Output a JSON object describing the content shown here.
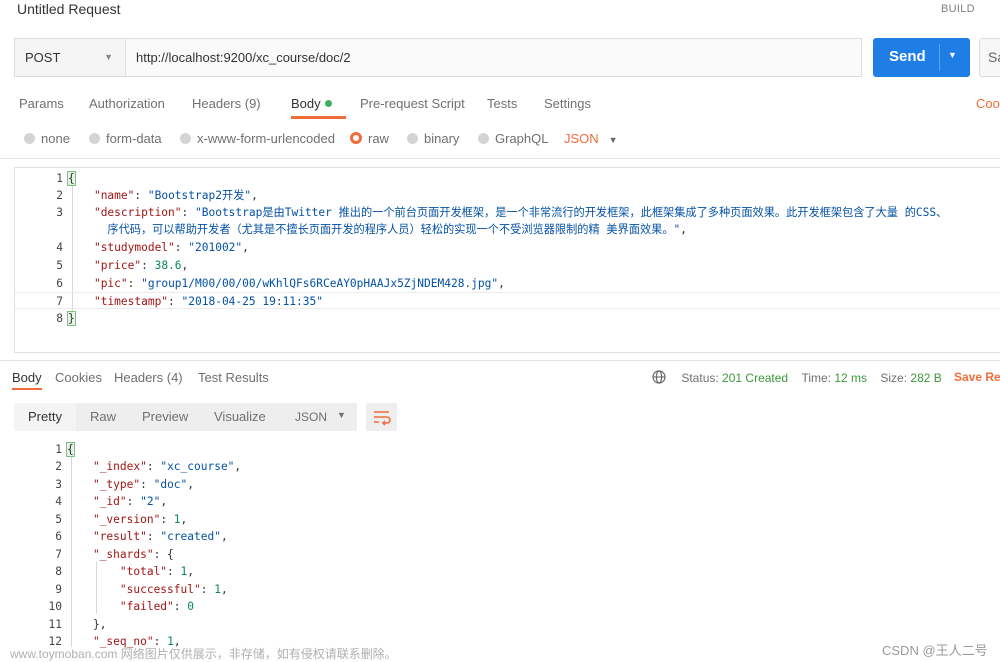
{
  "request": {
    "title": "Untitled Request",
    "build_label": "BUILD",
    "method": "POST",
    "url": "http://localhost:9200/xc_course/doc/2",
    "send_label": "Send",
    "save_label": "Sa"
  },
  "request_tabs": {
    "params": "Params",
    "authorization": "Authorization",
    "headers": "Headers (9)",
    "body": "Body",
    "prerequest": "Pre-request Script",
    "tests": "Tests",
    "settings": "Settings",
    "cookies": "Cooki"
  },
  "body_options": {
    "none": "none",
    "form_data": "form-data",
    "urlencoded": "x-www-form-urlencoded",
    "raw": "raw",
    "binary": "binary",
    "graphql": "GraphQL",
    "format": "JSON",
    "selected": "raw"
  },
  "request_body": {
    "n1": "1",
    "n2": "2",
    "n3": "3",
    "n4": "4",
    "n5": "5",
    "n6": "6",
    "n7": "7",
    "n8": "8",
    "open": "{",
    "close": "}",
    "k_name": "\"name\"",
    "v_name": "\"Bootstrap2开发\"",
    "k_desc": "\"description\"",
    "v_desc1": "\"Bootstrap是由Twitter 推出的一个前台页面开发框架，是一个非常流行的开发框架，此框架集成了多种页面效果。此开发框架包含了大量 的CSS、",
    "v_desc2": "序代码，可以帮助开发者（尤其是不擅长页面开发的程序人员）轻松的实现一个不受浏览器限制的精 美界面效果。\"",
    "k_study": "\"studymodel\"",
    "v_study": "\"201002\"",
    "k_price": "\"price\"",
    "v_price": "38.6",
    "k_pic": "\"pic\"",
    "v_pic": "\"group1/M00/00/00/wKhlQFs6RCeAY0pHAAJx5ZjNDEM428.jpg\"",
    "k_ts": "\"timestamp\"",
    "v_ts": "\"2018-04-25 19:11:35\""
  },
  "response_tabs": {
    "body": "Body",
    "cookies": "Cookies",
    "headers": "Headers (4)",
    "test_results": "Test Results"
  },
  "response_status": {
    "status_label": "Status:",
    "status_value": "201 Created",
    "time_label": "Time:",
    "time_value": "12 ms",
    "size_label": "Size:",
    "size_value": "282 B",
    "save_response": "Save Res"
  },
  "response_format": {
    "pretty": "Pretty",
    "raw": "Raw",
    "preview": "Preview",
    "visualize": "Visualize",
    "format": "JSON"
  },
  "response_body": {
    "n1": "1",
    "n2": "2",
    "n3": "3",
    "n4": "4",
    "n5": "5",
    "n6": "6",
    "n7": "7",
    "n8": "8",
    "n9": "9",
    "n10": "10",
    "n11": "11",
    "n12": "12",
    "open": "{",
    "k_index": "\"_index\"",
    "v_index": "\"xc_course\"",
    "k_type": "\"_type\"",
    "v_type": "\"doc\"",
    "k_id": "\"_id\"",
    "v_id": "\"2\"",
    "k_version": "\"_version\"",
    "v_version": "1",
    "k_result": "\"result\"",
    "v_result": "\"created\"",
    "k_shards": "\"_shards\"",
    "k_total": "\"total\"",
    "v_total": "1",
    "k_successful": "\"successful\"",
    "v_successful": "1",
    "k_failed": "\"failed\"",
    "v_failed": "0",
    "shards_close": "},",
    "k_seq": "\"_seq_no\"",
    "v_seq": "1"
  },
  "footer": {
    "watermark": "www.toymoban.com 网络图片仅供展示，非存储，如有侵权请联系删除。",
    "credit": "CSDN @王人二号"
  }
}
